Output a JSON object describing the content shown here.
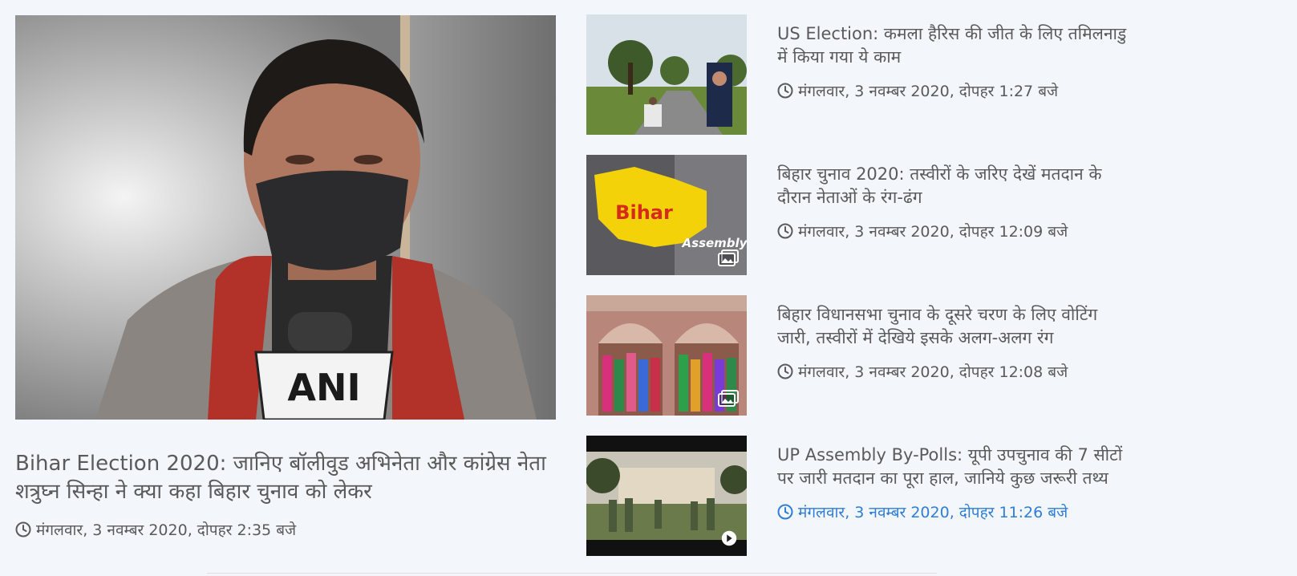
{
  "featured": {
    "title": "Bihar Election 2020: जानिए बॉलीवुड अभिनेता और कांग्रेस नेता शत्रुघ्न सिन्हा ने क्या कहा बिहार चुनाव को लेकर",
    "timestamp": "मंगलवार, 3 नवम्बर 2020, दोपहर 2:35 बजे",
    "image_text": "ANI"
  },
  "items": [
    {
      "title": "US Election: कमला हैरिस की जीत के लिए तमिलनाडु में किया गया ये काम",
      "timestamp": "मंगलवार, 3 नवम्बर 2020, दोपहर 1:27 बजे",
      "badge": ""
    },
    {
      "title": "बिहार चुनाव 2020: तस्वीरों के जरिए देखें मतदान के दौरान नेताओं के रंग-ढंग",
      "timestamp": "मंगलवार, 3 नवम्बर 2020, दोपहर 12:09 बजे",
      "badge": "gallery-icon",
      "image_text_1": "Bihar",
      "image_text_2": "Assembly"
    },
    {
      "title": "बिहार विधानसभा चुनाव के दूसरे चरण के लिए वोटिंग जारी, तस्वीरों में देखिये इसके अलग-अलग रंग",
      "timestamp": "मंगलवार, 3 नवम्बर 2020, दोपहर 12:08 बजे",
      "badge": "gallery-icon"
    },
    {
      "title": "UP Assembly By-Polls: यूपी उपचुनाव की 7 सीटों पर जारी मतदान का पूरा हाल, जानिये कुछ जरूरी तथ्य",
      "timestamp": "मंगलवार, 3 नवम्बर 2020, दोपहर 11:26 बजे",
      "badge": "play-icon"
    }
  ],
  "colors": {
    "background": "#f3f6fa",
    "text": "#5a5a5a",
    "active_link": "#2f7ed8"
  }
}
